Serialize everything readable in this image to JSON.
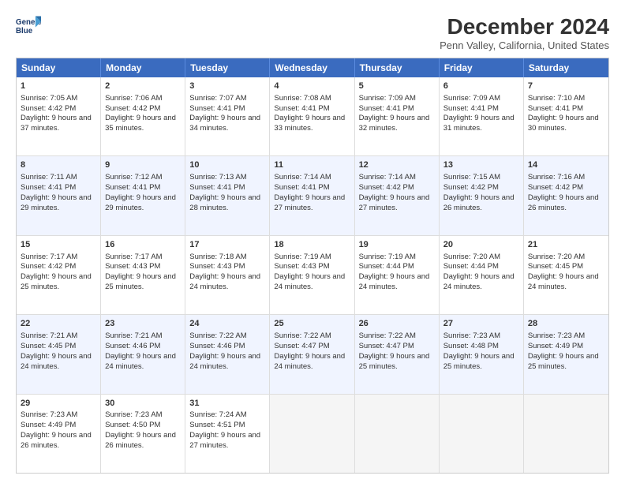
{
  "logo": {
    "line1": "General",
    "line2": "Blue"
  },
  "title": "December 2024",
  "subtitle": "Penn Valley, California, United States",
  "calendar": {
    "headers": [
      "Sunday",
      "Monday",
      "Tuesday",
      "Wednesday",
      "Thursday",
      "Friday",
      "Saturday"
    ],
    "rows": [
      [
        {
          "day": "1",
          "sunrise": "Sunrise: 7:05 AM",
          "sunset": "Sunset: 4:42 PM",
          "daylight": "Daylight: 9 hours and 37 minutes."
        },
        {
          "day": "2",
          "sunrise": "Sunrise: 7:06 AM",
          "sunset": "Sunset: 4:42 PM",
          "daylight": "Daylight: 9 hours and 35 minutes."
        },
        {
          "day": "3",
          "sunrise": "Sunrise: 7:07 AM",
          "sunset": "Sunset: 4:41 PM",
          "daylight": "Daylight: 9 hours and 34 minutes."
        },
        {
          "day": "4",
          "sunrise": "Sunrise: 7:08 AM",
          "sunset": "Sunset: 4:41 PM",
          "daylight": "Daylight: 9 hours and 33 minutes."
        },
        {
          "day": "5",
          "sunrise": "Sunrise: 7:09 AM",
          "sunset": "Sunset: 4:41 PM",
          "daylight": "Daylight: 9 hours and 32 minutes."
        },
        {
          "day": "6",
          "sunrise": "Sunrise: 7:09 AM",
          "sunset": "Sunset: 4:41 PM",
          "daylight": "Daylight: 9 hours and 31 minutes."
        },
        {
          "day": "7",
          "sunrise": "Sunrise: 7:10 AM",
          "sunset": "Sunset: 4:41 PM",
          "daylight": "Daylight: 9 hours and 30 minutes."
        }
      ],
      [
        {
          "day": "8",
          "sunrise": "Sunrise: 7:11 AM",
          "sunset": "Sunset: 4:41 PM",
          "daylight": "Daylight: 9 hours and 29 minutes."
        },
        {
          "day": "9",
          "sunrise": "Sunrise: 7:12 AM",
          "sunset": "Sunset: 4:41 PM",
          "daylight": "Daylight: 9 hours and 29 minutes."
        },
        {
          "day": "10",
          "sunrise": "Sunrise: 7:13 AM",
          "sunset": "Sunset: 4:41 PM",
          "daylight": "Daylight: 9 hours and 28 minutes."
        },
        {
          "day": "11",
          "sunrise": "Sunrise: 7:14 AM",
          "sunset": "Sunset: 4:41 PM",
          "daylight": "Daylight: 9 hours and 27 minutes."
        },
        {
          "day": "12",
          "sunrise": "Sunrise: 7:14 AM",
          "sunset": "Sunset: 4:42 PM",
          "daylight": "Daylight: 9 hours and 27 minutes."
        },
        {
          "day": "13",
          "sunrise": "Sunrise: 7:15 AM",
          "sunset": "Sunset: 4:42 PM",
          "daylight": "Daylight: 9 hours and 26 minutes."
        },
        {
          "day": "14",
          "sunrise": "Sunrise: 7:16 AM",
          "sunset": "Sunset: 4:42 PM",
          "daylight": "Daylight: 9 hours and 26 minutes."
        }
      ],
      [
        {
          "day": "15",
          "sunrise": "Sunrise: 7:17 AM",
          "sunset": "Sunset: 4:42 PM",
          "daylight": "Daylight: 9 hours and 25 minutes."
        },
        {
          "day": "16",
          "sunrise": "Sunrise: 7:17 AM",
          "sunset": "Sunset: 4:43 PM",
          "daylight": "Daylight: 9 hours and 25 minutes."
        },
        {
          "day": "17",
          "sunrise": "Sunrise: 7:18 AM",
          "sunset": "Sunset: 4:43 PM",
          "daylight": "Daylight: 9 hours and 24 minutes."
        },
        {
          "day": "18",
          "sunrise": "Sunrise: 7:19 AM",
          "sunset": "Sunset: 4:43 PM",
          "daylight": "Daylight: 9 hours and 24 minutes."
        },
        {
          "day": "19",
          "sunrise": "Sunrise: 7:19 AM",
          "sunset": "Sunset: 4:44 PM",
          "daylight": "Daylight: 9 hours and 24 minutes."
        },
        {
          "day": "20",
          "sunrise": "Sunrise: 7:20 AM",
          "sunset": "Sunset: 4:44 PM",
          "daylight": "Daylight: 9 hours and 24 minutes."
        },
        {
          "day": "21",
          "sunrise": "Sunrise: 7:20 AM",
          "sunset": "Sunset: 4:45 PM",
          "daylight": "Daylight: 9 hours and 24 minutes."
        }
      ],
      [
        {
          "day": "22",
          "sunrise": "Sunrise: 7:21 AM",
          "sunset": "Sunset: 4:45 PM",
          "daylight": "Daylight: 9 hours and 24 minutes."
        },
        {
          "day": "23",
          "sunrise": "Sunrise: 7:21 AM",
          "sunset": "Sunset: 4:46 PM",
          "daylight": "Daylight: 9 hours and 24 minutes."
        },
        {
          "day": "24",
          "sunrise": "Sunrise: 7:22 AM",
          "sunset": "Sunset: 4:46 PM",
          "daylight": "Daylight: 9 hours and 24 minutes."
        },
        {
          "day": "25",
          "sunrise": "Sunrise: 7:22 AM",
          "sunset": "Sunset: 4:47 PM",
          "daylight": "Daylight: 9 hours and 24 minutes."
        },
        {
          "day": "26",
          "sunrise": "Sunrise: 7:22 AM",
          "sunset": "Sunset: 4:47 PM",
          "daylight": "Daylight: 9 hours and 25 minutes."
        },
        {
          "day": "27",
          "sunrise": "Sunrise: 7:23 AM",
          "sunset": "Sunset: 4:48 PM",
          "daylight": "Daylight: 9 hours and 25 minutes."
        },
        {
          "day": "28",
          "sunrise": "Sunrise: 7:23 AM",
          "sunset": "Sunset: 4:49 PM",
          "daylight": "Daylight: 9 hours and 25 minutes."
        }
      ],
      [
        {
          "day": "29",
          "sunrise": "Sunrise: 7:23 AM",
          "sunset": "Sunset: 4:49 PM",
          "daylight": "Daylight: 9 hours and 26 minutes."
        },
        {
          "day": "30",
          "sunrise": "Sunrise: 7:23 AM",
          "sunset": "Sunset: 4:50 PM",
          "daylight": "Daylight: 9 hours and 26 minutes."
        },
        {
          "day": "31",
          "sunrise": "Sunrise: 7:24 AM",
          "sunset": "Sunset: 4:51 PM",
          "daylight": "Daylight: 9 hours and 27 minutes."
        },
        null,
        null,
        null,
        null
      ]
    ]
  }
}
